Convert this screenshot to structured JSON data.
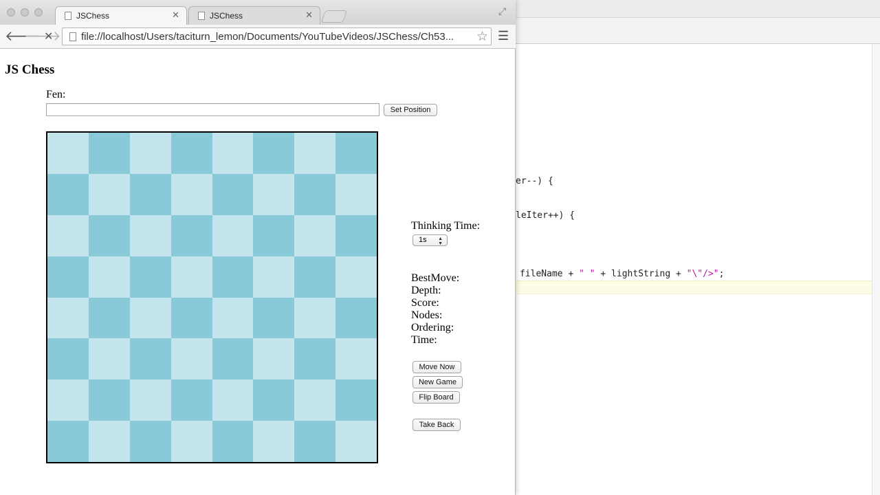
{
  "browser": {
    "tabs": [
      {
        "title": "JSChess",
        "active": true
      },
      {
        "title": "JSChess",
        "active": false
      }
    ],
    "url": "file://localhost/Users/taciturn_lemon/Documents/YouTubeVideos/JSChess/Ch53..."
  },
  "page": {
    "title": "JS Chess",
    "fen_label": "Fen:",
    "fen_value": "",
    "set_position_label": "Set Position",
    "thinking_time_label": "Thinking Time:",
    "thinking_time_value": "1s",
    "stats": {
      "best_move": "BestMove:",
      "depth": "Depth:",
      "score": "Score:",
      "nodes": "Nodes:",
      "ordering": "Ordering:",
      "time": "Time:"
    },
    "buttons": {
      "move_now": "Move Now",
      "new_game": "New Game",
      "flip_board": "Flip Board",
      "take_back": "Take Back"
    },
    "board": {
      "light_color": "#c4e4ec",
      "dark_color": "#89cad9"
    }
  },
  "editor": {
    "line1": "er--) {",
    "line2": "leIter++) {",
    "line3_a": "fileName + ",
    "line3_b": "\" \"",
    "line3_c": " + lightString + ",
    "line3_d": "\"\\\"/>\"",
    "line3_e": ";"
  }
}
